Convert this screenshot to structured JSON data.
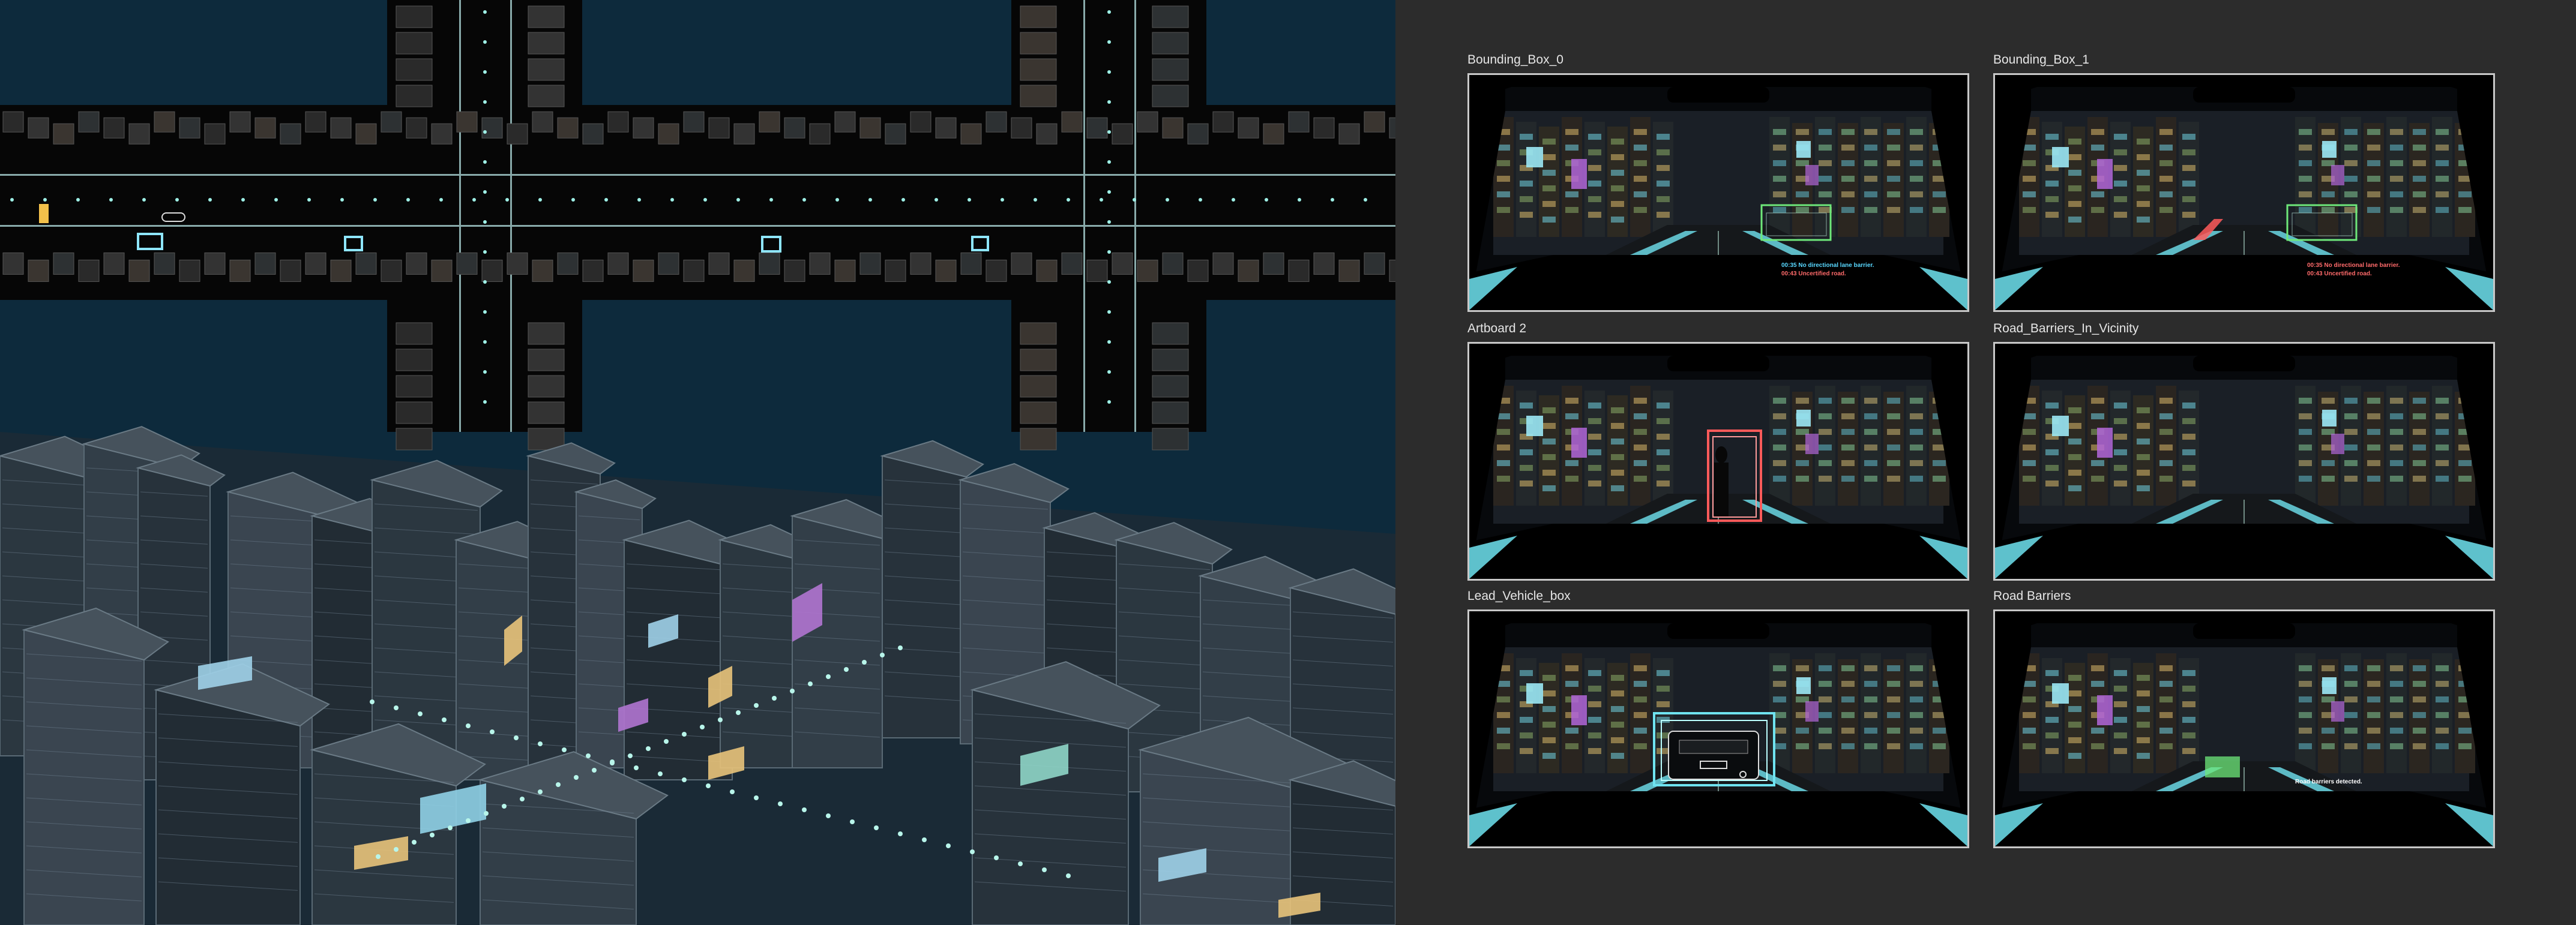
{
  "artboards": [
    {
      "label": "Bounding_Box_0",
      "overlay": "box-green",
      "alerts": [
        {
          "text": "00:35 No directional lane barrier.",
          "color": "#58d7ff"
        },
        {
          "text": "00:43 Uncertified road.",
          "color": "#ff6a6a"
        }
      ]
    },
    {
      "label": "Bounding_Box_1",
      "overlay": "box-green-redbar",
      "alerts": [
        {
          "text": "00:35 No directional lane barrier.",
          "color": "#ff6a6a"
        },
        {
          "text": "00:43 Uncertified road.",
          "color": "#ff6a6a"
        }
      ]
    },
    {
      "label": "Artboard 2",
      "overlay": "pedestrian-box",
      "alerts": []
    },
    {
      "label": "Road_Barriers_In_Vicinity",
      "overlay": "none",
      "alerts": []
    },
    {
      "label": "Lead_Vehicle_box",
      "overlay": "vehicle-box",
      "alerts": []
    },
    {
      "label": "Road Barriers",
      "overlay": "barrier-box",
      "alerts": [
        {
          "text": "Road barriers detected.",
          "color": "#ffffff"
        }
      ]
    }
  ],
  "colors": {
    "viewport_bg": "#0d2a3c",
    "panel_bg": "#2c2c2c",
    "neon_cyan": "#6fe3f0",
    "neon_green": "#6ee87a",
    "neon_red": "#ff5a5a",
    "neon_yellow": "#f5c86a",
    "neon_purple": "#b266d9"
  }
}
